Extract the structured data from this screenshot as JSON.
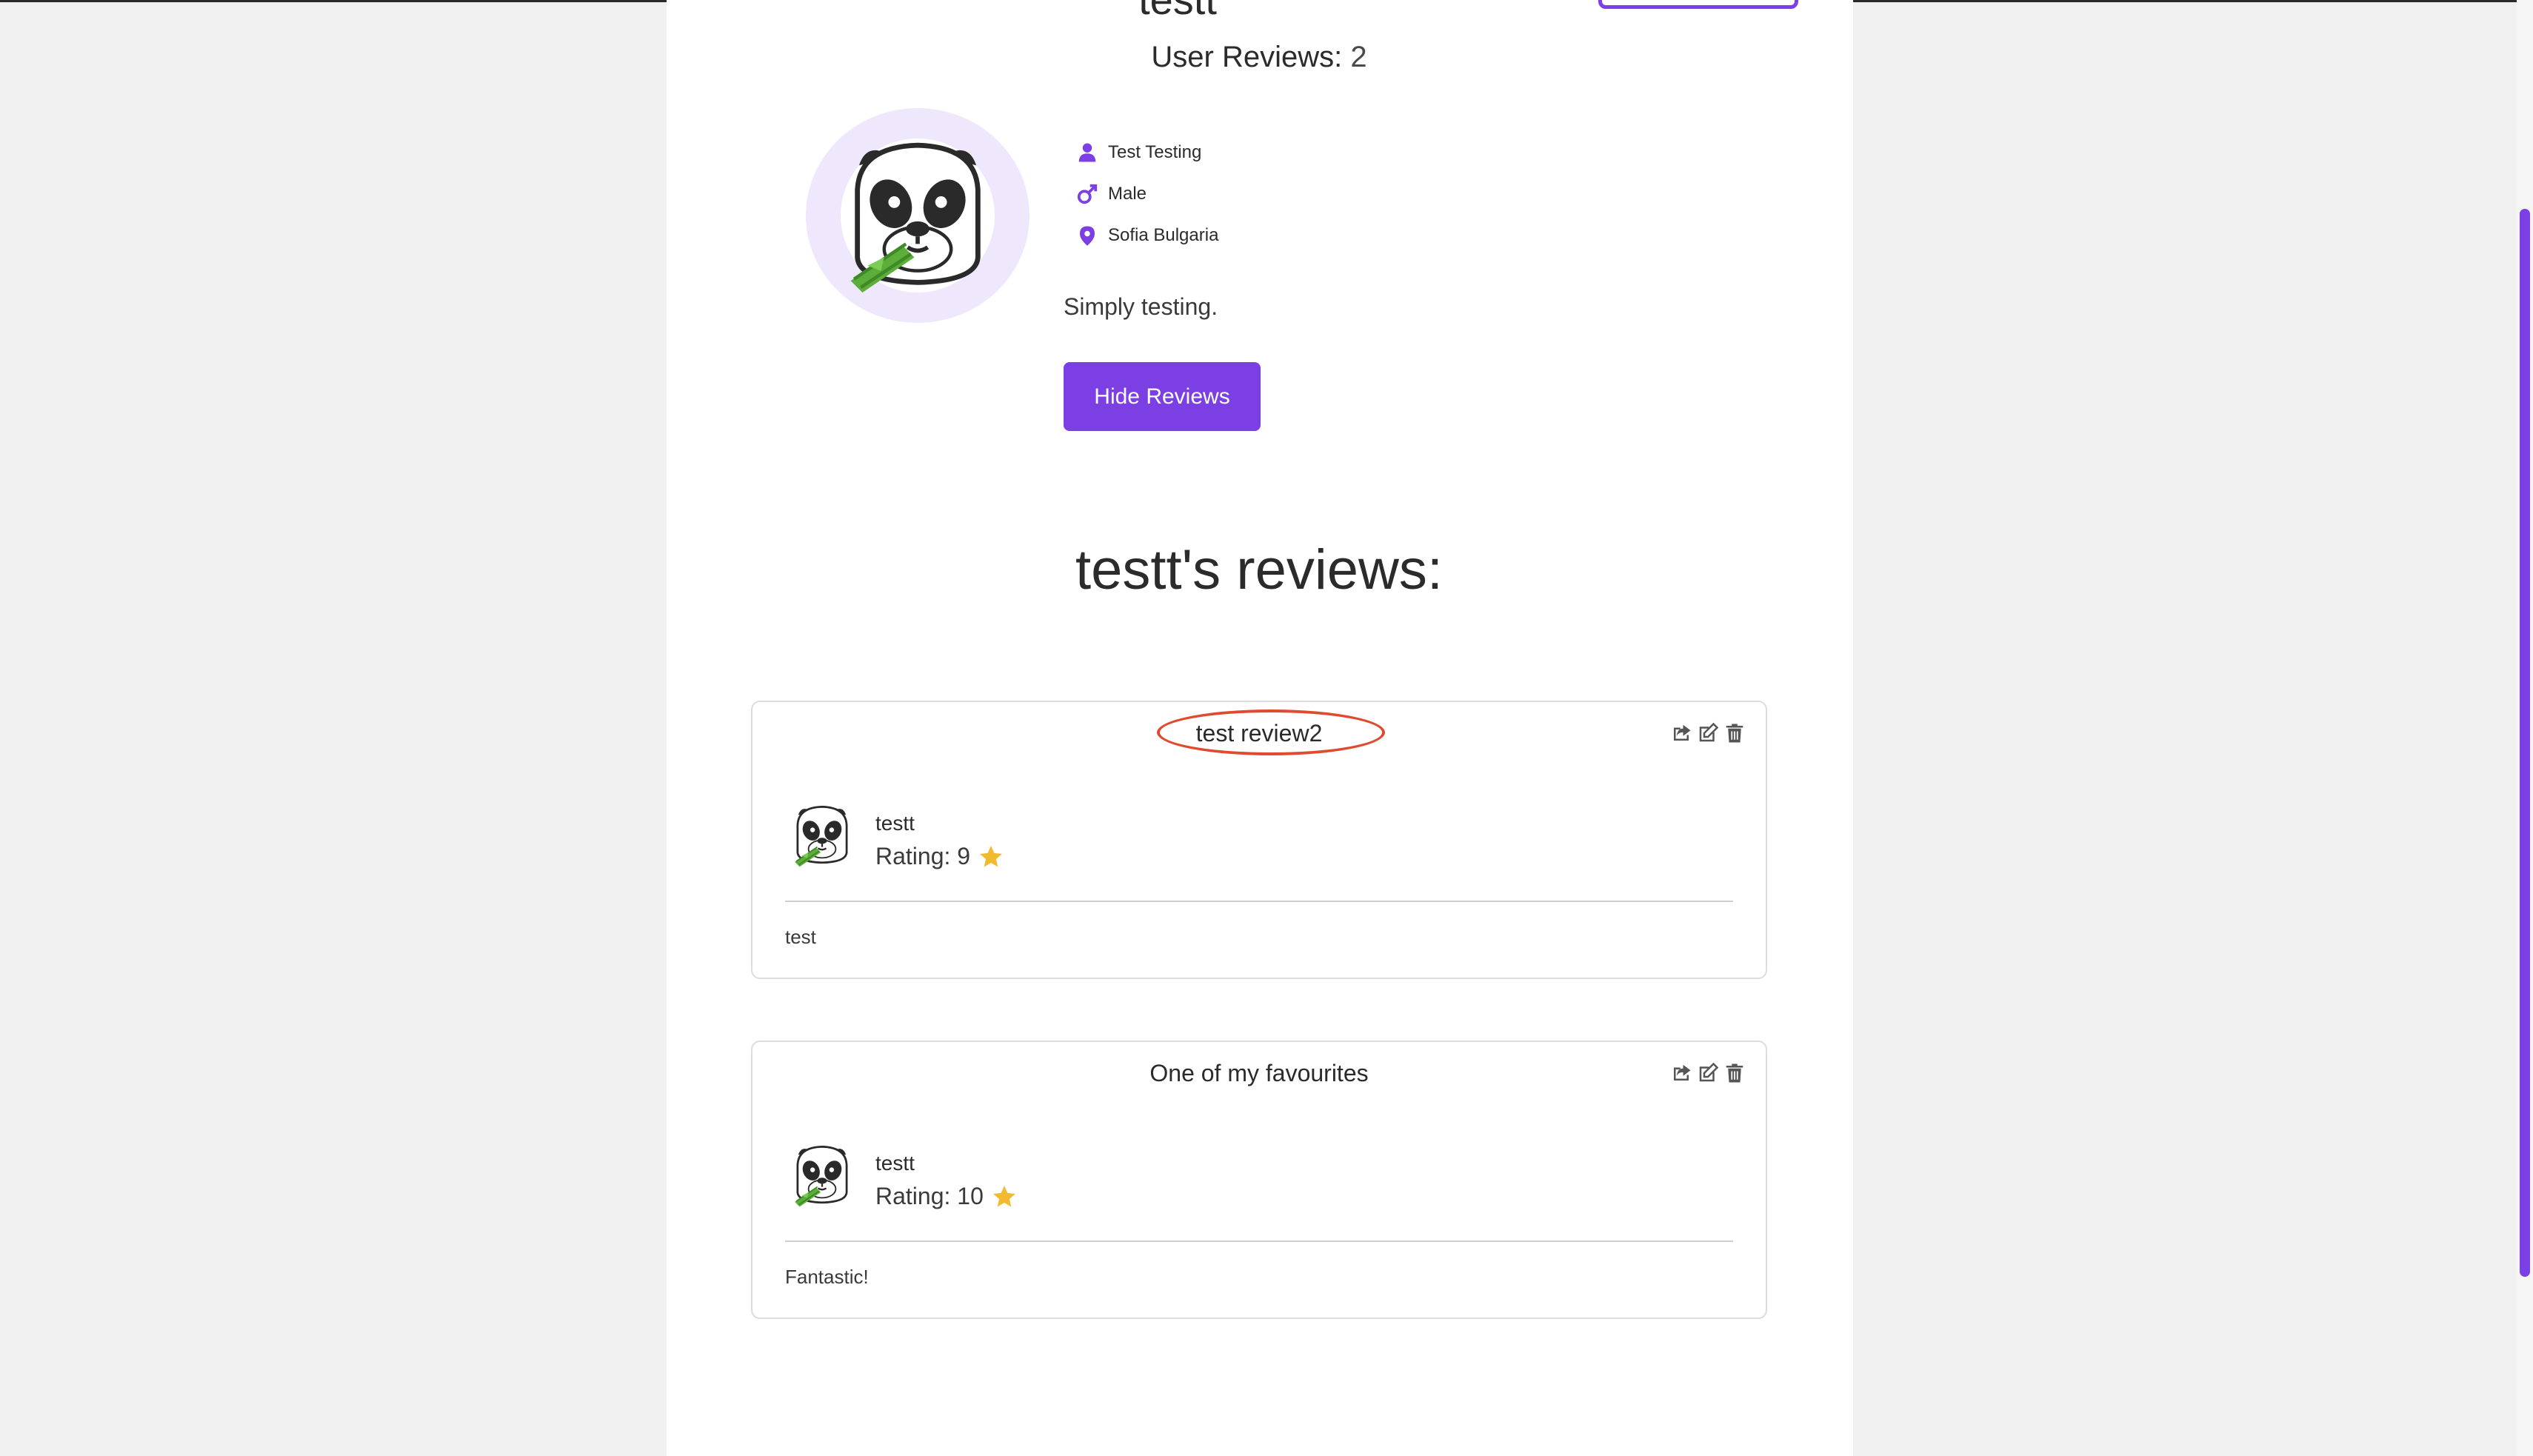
{
  "profile": {
    "username": "testt",
    "reviews_label": "User Reviews:",
    "reviews_count": "2",
    "full_name": "Test Testing",
    "gender": "Male",
    "location": "Sofia Bulgaria",
    "bio": "Simply testing.",
    "hide_reviews_label": "Hide Reviews"
  },
  "reviews_section": {
    "heading": "testt's reviews:"
  },
  "reviews": [
    {
      "title": "test review2",
      "author": "testt",
      "rating_label": "Rating: 9",
      "body": "test"
    },
    {
      "title": "One of my favourites",
      "author": "testt",
      "rating_label": "Rating: 10",
      "body": "Fantastic!"
    }
  ],
  "colors": {
    "accent": "#7b3fe4",
    "highlight_circle": "#e04a2f",
    "star": "#f2bb2f",
    "avatar_bg": "#efe8fc"
  },
  "icons": [
    "user-icon",
    "male-icon",
    "location-pin-icon",
    "share-icon",
    "edit-icon",
    "trash-icon",
    "star-icon",
    "panda-avatar"
  ]
}
